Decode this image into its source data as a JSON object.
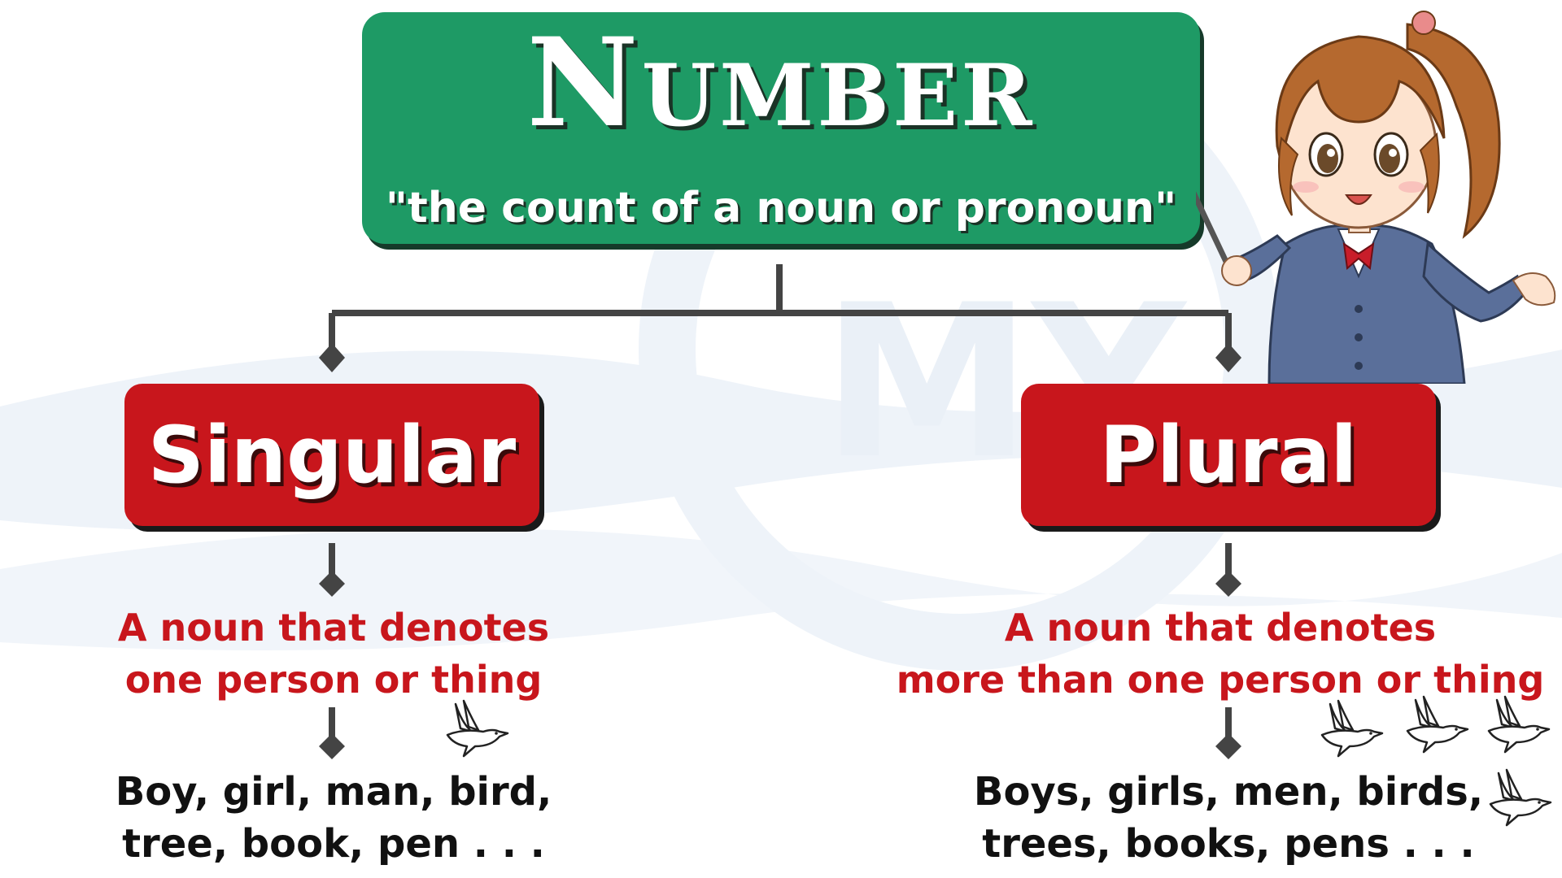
{
  "title": "Number",
  "subtitle": "\"the count of a noun or pronoun\"",
  "singular": {
    "label": "Singular",
    "definition_lines": [
      "A noun that denotes",
      "one person or thing"
    ],
    "example_lines": [
      "Boy, girl, man, bird,",
      "tree, book, pen . . ."
    ],
    "bird_icon_count": 1
  },
  "plural": {
    "label": "Plural",
    "definition_lines": [
      "A noun that denotes",
      "more than one person or thing"
    ],
    "example_lines": [
      "Boys, girls, men, birds,",
      "trees, books, pens . . ."
    ],
    "bird_icon_count": 4
  },
  "colors": {
    "title_green": "#1e9a65",
    "category_red": "#c8161c",
    "connector_gray": "#444444"
  },
  "icons": [
    "bird-icon",
    "teacher-illustration",
    "diamond-arrow-icon"
  ]
}
